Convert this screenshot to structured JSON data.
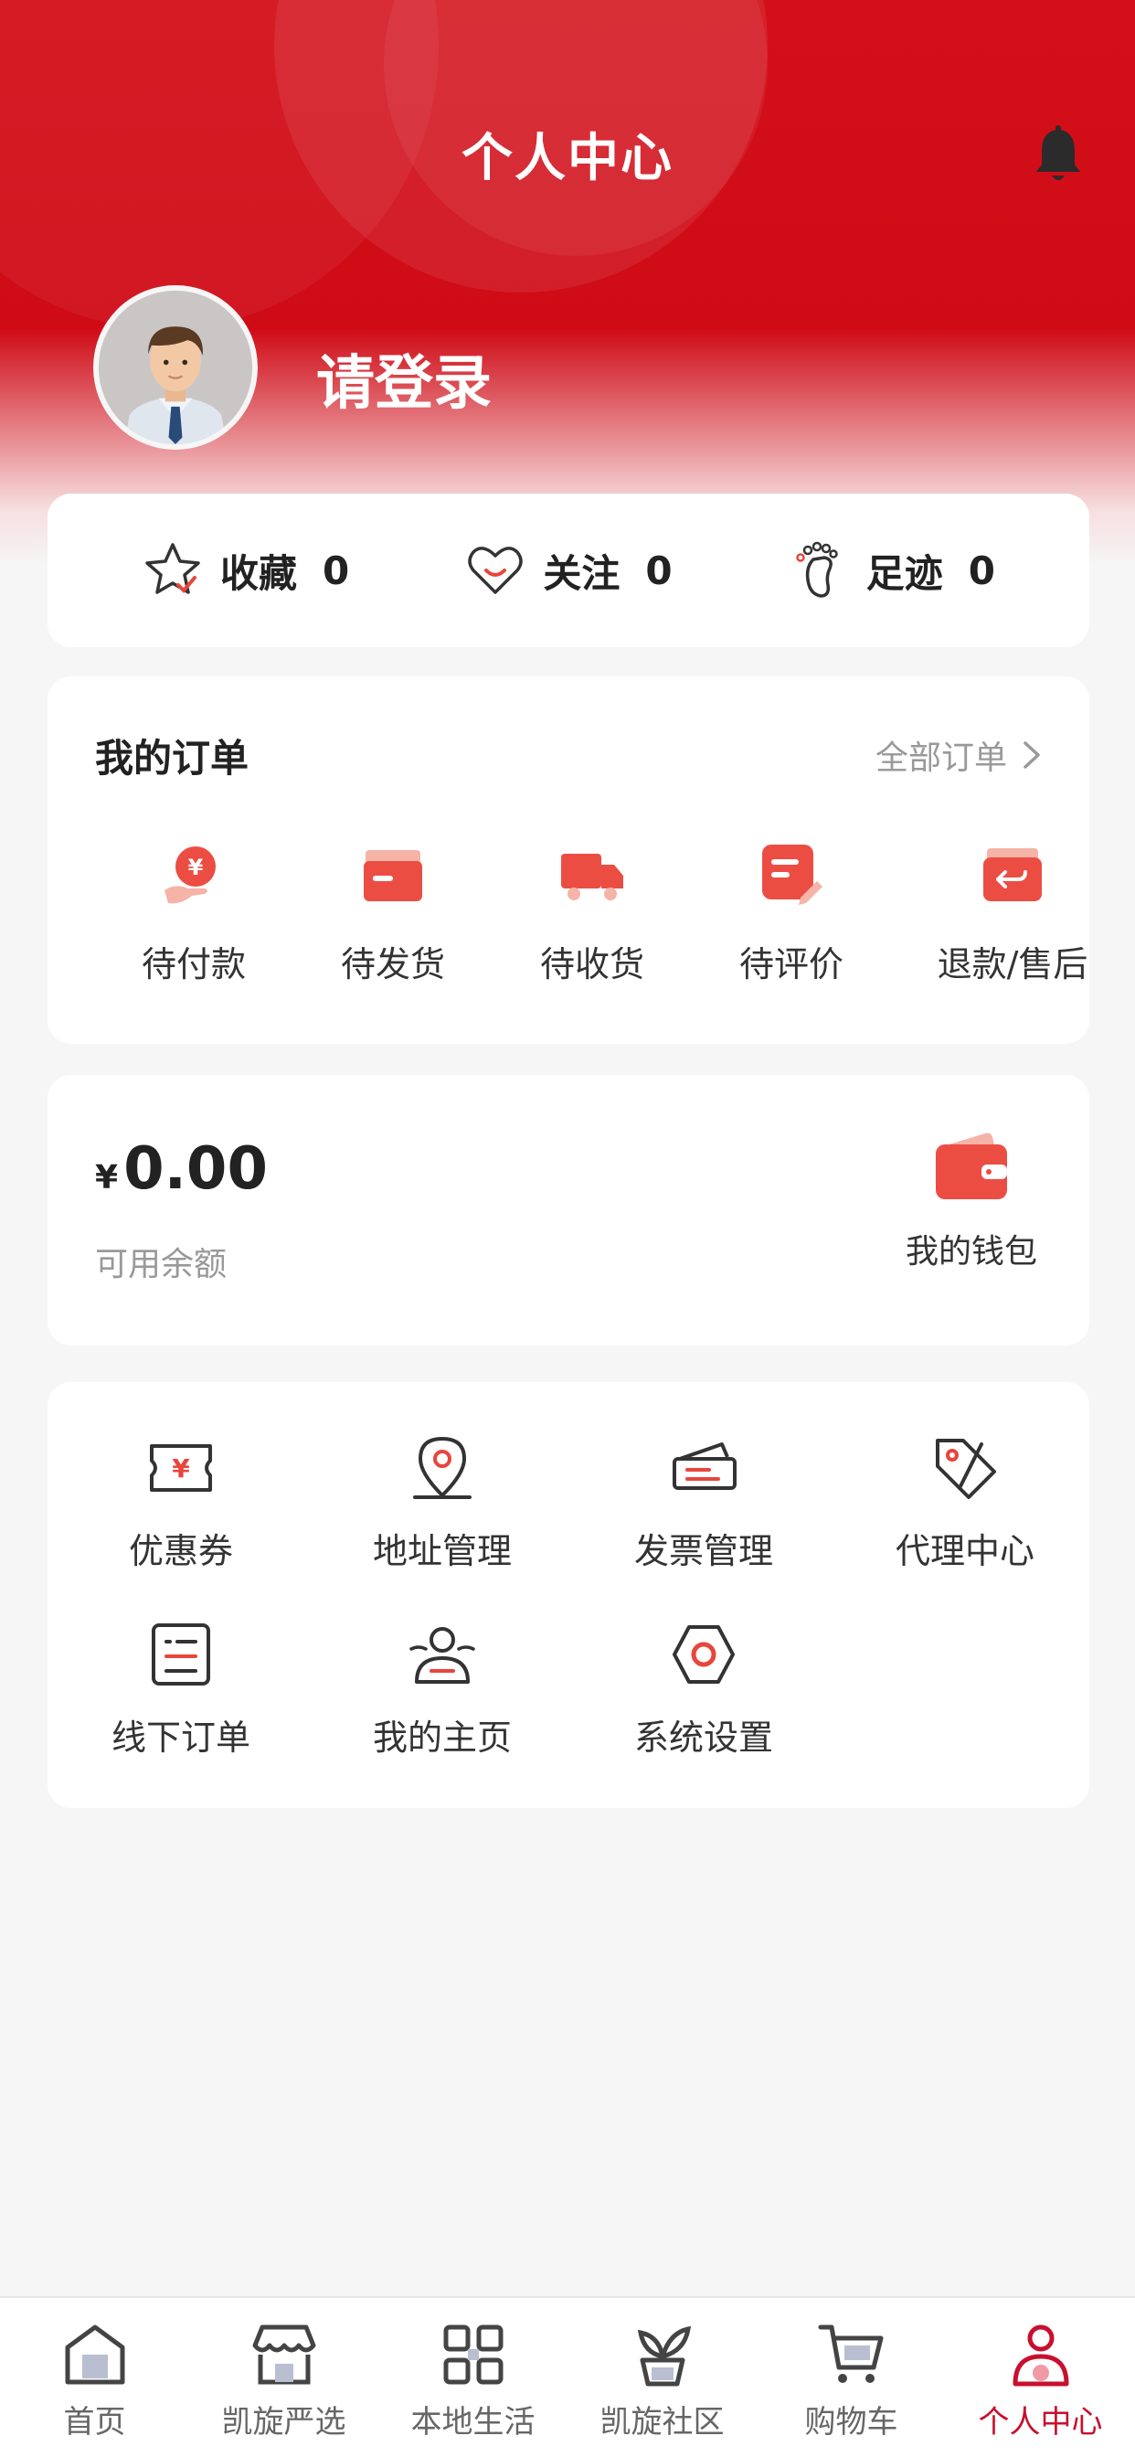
{
  "header": {
    "title": "个人中心",
    "bell_icon": "bell-icon",
    "avatar_icon": "user-avatar",
    "login_text": "请登录"
  },
  "stats": [
    {
      "label": "收藏",
      "count": "0",
      "icon": "star-icon"
    },
    {
      "label": "关注",
      "count": "0",
      "icon": "heart-icon"
    },
    {
      "label": "足迹",
      "count": "0",
      "icon": "footprint-icon"
    }
  ],
  "orders": {
    "title": "我的订单",
    "all_label": "全部订单",
    "items": [
      {
        "label": "待付款",
        "icon": "payment-icon"
      },
      {
        "label": "待发货",
        "icon": "box-icon"
      },
      {
        "label": "待收货",
        "icon": "truck-icon"
      },
      {
        "label": "待评价",
        "icon": "review-icon"
      },
      {
        "label": "退款/售后",
        "icon": "refund-icon"
      }
    ]
  },
  "wallet": {
    "currency": "¥",
    "amount": "0.00",
    "balance_label": "可用余额",
    "wallet_label": "我的钱包"
  },
  "tools": [
    {
      "label": "优惠券",
      "icon": "coupon-icon"
    },
    {
      "label": "地址管理",
      "icon": "location-icon"
    },
    {
      "label": "发票管理",
      "icon": "invoice-icon"
    },
    {
      "label": "代理中心",
      "icon": "tag-icon"
    },
    {
      "label": "线下订单",
      "icon": "list-icon"
    },
    {
      "label": "我的主页",
      "icon": "person-icon"
    },
    {
      "label": "系统设置",
      "icon": "settings-icon"
    }
  ],
  "tabbar": {
    "active": "个人中心",
    "items": [
      {
        "label": "首页",
        "icon": "home-icon"
      },
      {
        "label": "凯旋严选",
        "icon": "store-icon"
      },
      {
        "label": "本地生活",
        "icon": "grid-icon"
      },
      {
        "label": "凯旋社区",
        "icon": "plant-icon"
      },
      {
        "label": "购物车",
        "icon": "cart-icon"
      },
      {
        "label": "个人中心",
        "icon": "profile-icon"
      }
    ]
  },
  "colors": {
    "brand_red": "#d3101a",
    "accent_red": "#e8453c",
    "tab_active": "#c8102e"
  }
}
